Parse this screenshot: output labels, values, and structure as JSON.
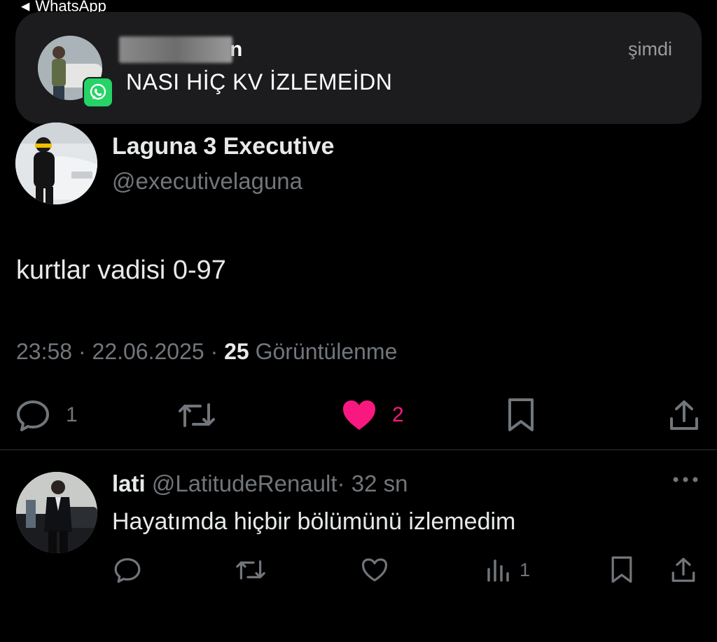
{
  "status_bar": {
    "back_label": "WhatsApp"
  },
  "notification": {
    "sender_suffix": "n",
    "message": "NASI HİÇ KV İZLEMEİDN",
    "time": "şimdi",
    "app_badge_icon": "whatsapp-icon",
    "accent": "#25d366"
  },
  "tweet": {
    "display_name": "Laguna 3 Executive",
    "handle": "@executivelaguna",
    "text": "kurtlar vadisi 0-97",
    "time": "23:58",
    "date": "22.06.2025",
    "views_count": "25",
    "views_label": "Görüntülenme",
    "separator": "·",
    "reply_count": "1",
    "like_count": "2",
    "like_color": "#f91880",
    "liked": true
  },
  "reply": {
    "display_name": "lati",
    "handle": "@LatitudeRenault",
    "separator": "·",
    "age": "32 sn",
    "text": "Hayatımda hiçbir bölümünü izlemedim",
    "views_count": "1"
  }
}
